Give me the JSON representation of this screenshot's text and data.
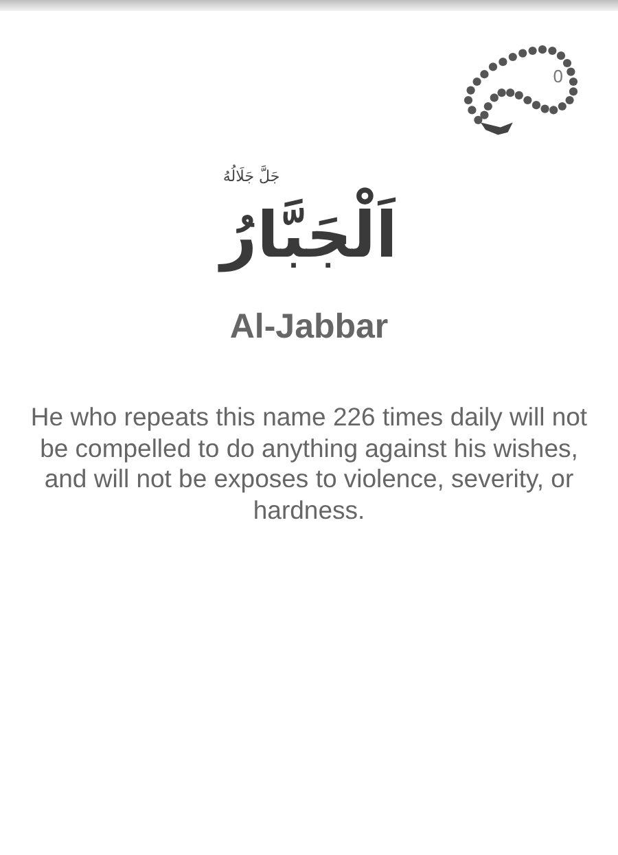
{
  "counter": {
    "count": "0"
  },
  "name": {
    "arabic": "اَلْجَبَّارُ",
    "honorific": "جَلَّ جَلَالُهُ",
    "transliteration": "Al-Jabbar"
  },
  "description": "He who repeats this name 226 times daily will not be compelled to do anything against his wishes, and will not be exposes to violence, severity, or hardness."
}
